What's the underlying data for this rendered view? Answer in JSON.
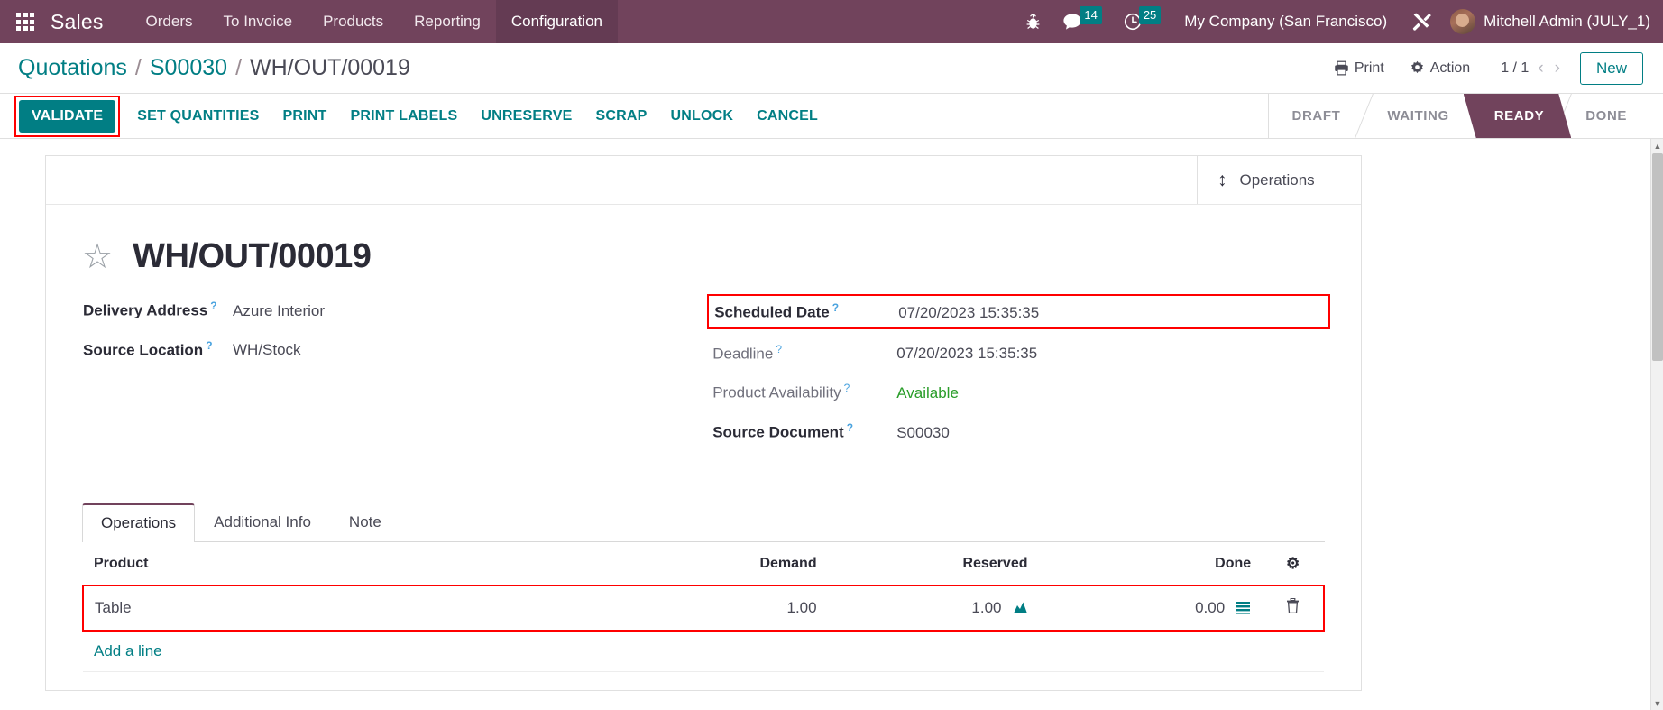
{
  "navbar": {
    "apps_icon": "apps-grid-icon",
    "brand": "Sales",
    "menu": [
      {
        "label": "Orders",
        "active": false
      },
      {
        "label": "To Invoice",
        "active": false
      },
      {
        "label": "Products",
        "active": false
      },
      {
        "label": "Reporting",
        "active": false
      },
      {
        "label": "Configuration",
        "active": true
      }
    ],
    "bug_icon": "bug-icon",
    "messages": {
      "icon": "chat-bubble-icon",
      "count": "14"
    },
    "activities": {
      "icon": "clock-icon",
      "count": "25"
    },
    "company": "My Company (San Francisco)",
    "tools_icon": "wrench-screwdriver-icon",
    "user": "Mitchell Admin (JULY_1)"
  },
  "control_panel": {
    "breadcrumb": [
      "Quotations",
      "S00030",
      "WH/OUT/00019"
    ],
    "separator": "/",
    "print": "Print",
    "print_icon": "printer-icon",
    "action": "Action",
    "action_icon": "gear-icon",
    "pager": "1 / 1",
    "prev_icon": "chevron-left-icon",
    "next_icon": "chevron-right-icon",
    "new_button": "New"
  },
  "statusbar": {
    "buttons": [
      {
        "label": "VALIDATE",
        "primary": true,
        "highlighted": true
      },
      {
        "label": "SET QUANTITIES",
        "primary": false,
        "highlighted": false
      },
      {
        "label": "PRINT",
        "primary": false,
        "highlighted": false
      },
      {
        "label": "PRINT LABELS",
        "primary": false,
        "highlighted": false
      },
      {
        "label": "UNRESERVE",
        "primary": false,
        "highlighted": false
      },
      {
        "label": "SCRAP",
        "primary": false,
        "highlighted": false
      },
      {
        "label": "UNLOCK",
        "primary": false,
        "highlighted": false
      },
      {
        "label": "CANCEL",
        "primary": false,
        "highlighted": false
      }
    ],
    "stages": [
      {
        "label": "DRAFT",
        "active": false
      },
      {
        "label": "WAITING",
        "active": false
      },
      {
        "label": "READY",
        "active": true
      },
      {
        "label": "DONE",
        "active": false
      }
    ]
  },
  "sheet": {
    "stat_button": {
      "icon": "arrows-vertical-icon",
      "label": "Operations"
    },
    "star_icon": "star-outline-icon",
    "title": "WH/OUT/00019",
    "left_fields": [
      {
        "label": "Delivery Address",
        "value": "Azure Interior",
        "help": "?",
        "bold": true
      },
      {
        "label": "Source Location",
        "value": "WH/Stock",
        "help": "?",
        "bold": true
      }
    ],
    "right_fields": [
      {
        "label": "Scheduled Date",
        "value": "07/20/2023 15:35:35",
        "help": "?",
        "bold": true,
        "highlighted": true,
        "green": false
      },
      {
        "label": "Deadline",
        "value": "07/20/2023 15:35:35",
        "help": "?",
        "bold": false,
        "highlighted": false,
        "green": false
      },
      {
        "label": "Product Availability",
        "value": "Available",
        "help": "?",
        "bold": false,
        "highlighted": false,
        "green": true
      },
      {
        "label": "Source Document",
        "value": "S00030",
        "help": "?",
        "bold": true,
        "highlighted": false,
        "green": false
      }
    ],
    "tabs": [
      {
        "label": "Operations",
        "active": true
      },
      {
        "label": "Additional Info",
        "active": false
      },
      {
        "label": "Note",
        "active": false
      }
    ],
    "table": {
      "columns": [
        "Product",
        "Demand",
        "Reserved",
        "Done"
      ],
      "optional_columns_icon": "sliders-icon",
      "rows": [
        {
          "product": "Table",
          "demand": "1.00",
          "reserved": "1.00",
          "reserved_icon": "lots-chart-icon",
          "done": "0.00",
          "done_icon": "detail-list-icon",
          "delete_icon": "trash-icon",
          "highlighted": true
        }
      ],
      "add_line": "Add a line"
    }
  },
  "scrollbar": {
    "up_icon": "triangle-up-icon",
    "down_icon": "triangle-down-icon"
  },
  "colors": {
    "brand_purple": "#71435c",
    "accent_teal": "#017e84",
    "highlight_red": "#ff0000",
    "available_green": "#2a9d2a"
  }
}
